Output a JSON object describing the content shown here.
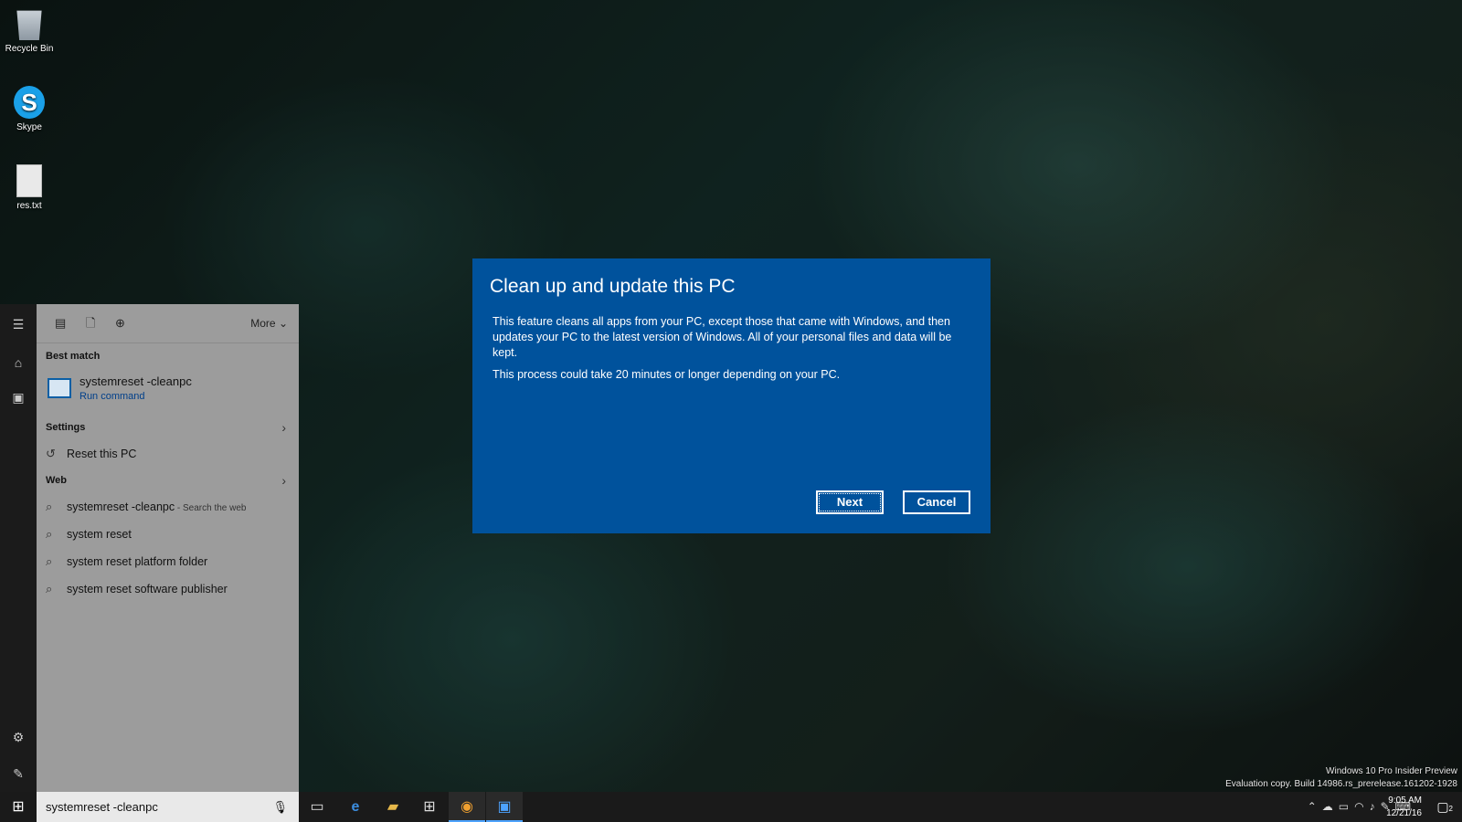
{
  "desktop": {
    "icons": [
      {
        "label": "Recycle Bin",
        "icon": "recycle-bin-icon"
      },
      {
        "label": "Skype",
        "icon": "skype-icon"
      },
      {
        "label": "res.txt",
        "icon": "text-file-icon"
      }
    ],
    "watermark": {
      "line1": "Windows 10 Pro Insider Preview",
      "line2": "Evaluation copy. Build 14986.rs_prerelease.161202-1928"
    }
  },
  "search_panel": {
    "toolbar_more": "More",
    "best_match_header": "Best match",
    "best_match": {
      "title": "systemreset -cleanpc",
      "subtitle": "Run command"
    },
    "settings_header": "Settings",
    "settings_items": [
      {
        "label": "Reset this PC",
        "icon": "history-icon"
      }
    ],
    "web_header": "Web",
    "web_items": [
      {
        "label": "systemreset -cleanpc",
        "sub": " - Search the web"
      },
      {
        "label": "system reset",
        "sub": ""
      },
      {
        "label": "system reset platform folder",
        "sub": ""
      },
      {
        "label": "system reset software publisher",
        "sub": ""
      }
    ],
    "query": "systemreset -cleanpc"
  },
  "dialog": {
    "title": "Clean up and update this PC",
    "body1": "This feature cleans all apps from your PC, except those that came with Windows, and then updates your PC to the latest version of Windows. All of your personal files and data will be kept.",
    "body2": "This process could take 20 minutes or longer depending on your PC.",
    "next_label": "Next",
    "cancel_label": "Cancel",
    "bg_color": "#00529c"
  },
  "taskbar": {
    "time": "9:05 AM",
    "date": "12/21/16",
    "notification_count": "2"
  }
}
